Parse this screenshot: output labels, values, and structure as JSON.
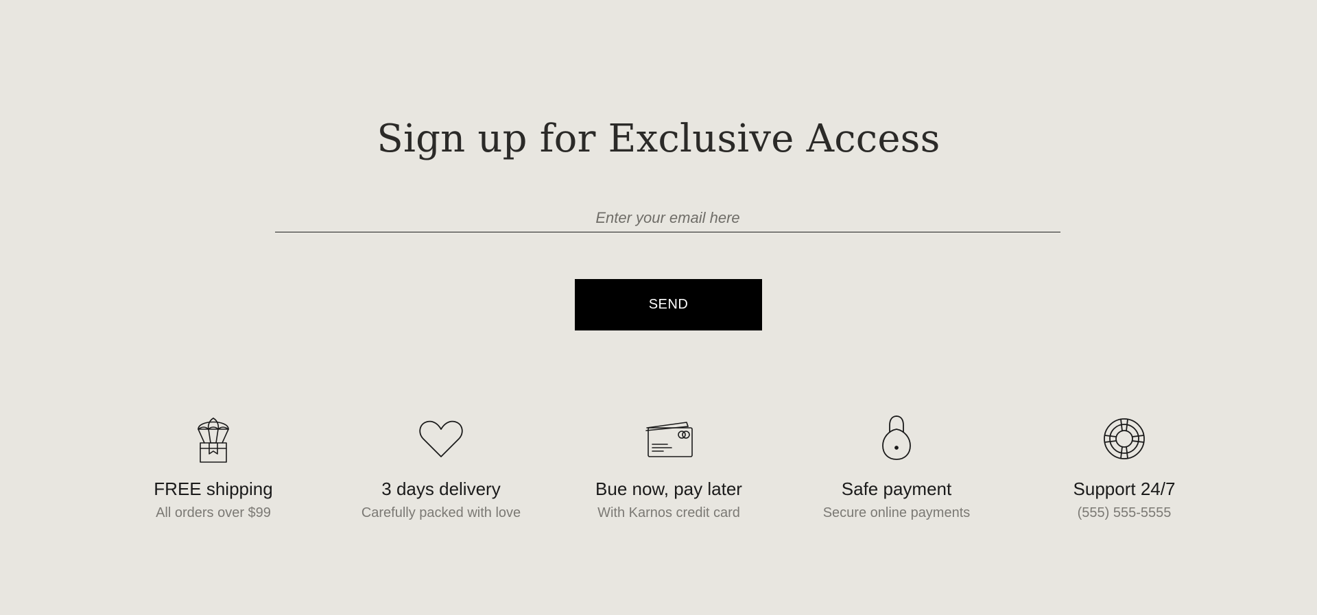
{
  "newsletter": {
    "title": "Sign up for Exclusive Access",
    "email_placeholder": "Enter your email here",
    "email_value": "",
    "send_label": "SEND"
  },
  "features": [
    {
      "icon": "parachute-box-icon",
      "title": "FREE shipping",
      "subtitle": "All orders over $99"
    },
    {
      "icon": "heart-icon",
      "title": "3 days delivery",
      "subtitle": "Carefully packed with love"
    },
    {
      "icon": "credit-card-icon",
      "title": "Bue now, pay later",
      "subtitle": "With Karnos credit card"
    },
    {
      "icon": "padlock-icon",
      "title": "Safe payment",
      "subtitle": "Secure online payments"
    },
    {
      "icon": "lifebuoy-icon",
      "title": "Support 24/7",
      "subtitle": "(555) 555-5555"
    }
  ],
  "colors": {
    "background": "#e8e6e0",
    "button": "#000000",
    "button_text": "#ffffff",
    "heading": "#2b2a28",
    "subtext": "#7b7974"
  }
}
